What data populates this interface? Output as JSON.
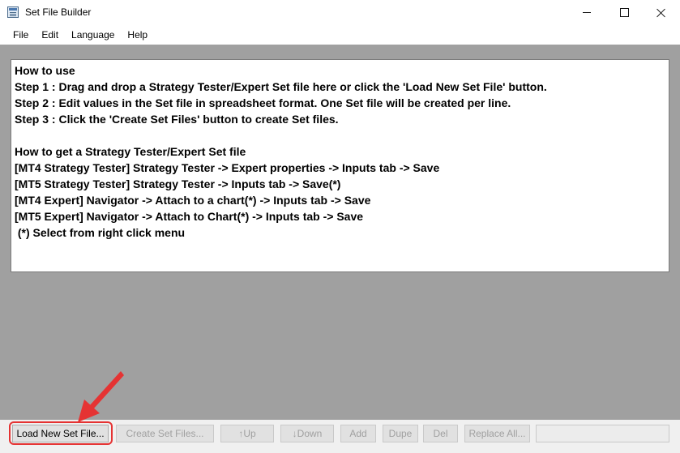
{
  "window": {
    "title": "Set File Builder",
    "icon": "app-icon"
  },
  "menu": [
    {
      "label": "File"
    },
    {
      "label": "Edit"
    },
    {
      "label": "Language"
    },
    {
      "label": "Help"
    }
  ],
  "instructions": [
    "How to use",
    "Step 1 : Drag and drop a Strategy Tester/Expert Set file here or click the 'Load New Set File' button.",
    "Step 2 : Edit values in the Set file in spreadsheet format. One Set file will be created per line.",
    "Step 3 : Click the 'Create Set Files' button to create Set files.",
    "",
    "How to get a Strategy Tester/Expert Set file",
    "[MT4 Strategy Tester] Strategy Tester -> Expert properties -> Inputs tab -> Save",
    "[MT5 Strategy Tester] Strategy Tester -> Inputs tab -> Save(*)",
    "[MT4 Expert] Navigator -> Attach to a chart(*) -> Inputs tab -> Save",
    "[MT5 Expert] Navigator -> Attach to Chart(*) -> Inputs tab -> Save",
    " (*) Select from right click menu"
  ],
  "toolbar": {
    "load_label": "Load New Set File...",
    "create_label": "Create Set Files...",
    "up_label": "↑Up",
    "down_label": "↓Down",
    "add_label": "Add",
    "dupe_label": "Dupe",
    "del_label": "Del",
    "replace_label": "Replace All...",
    "status_value": ""
  },
  "colors": {
    "annotation": "#e53333",
    "client_background": "#a0a0a0"
  }
}
